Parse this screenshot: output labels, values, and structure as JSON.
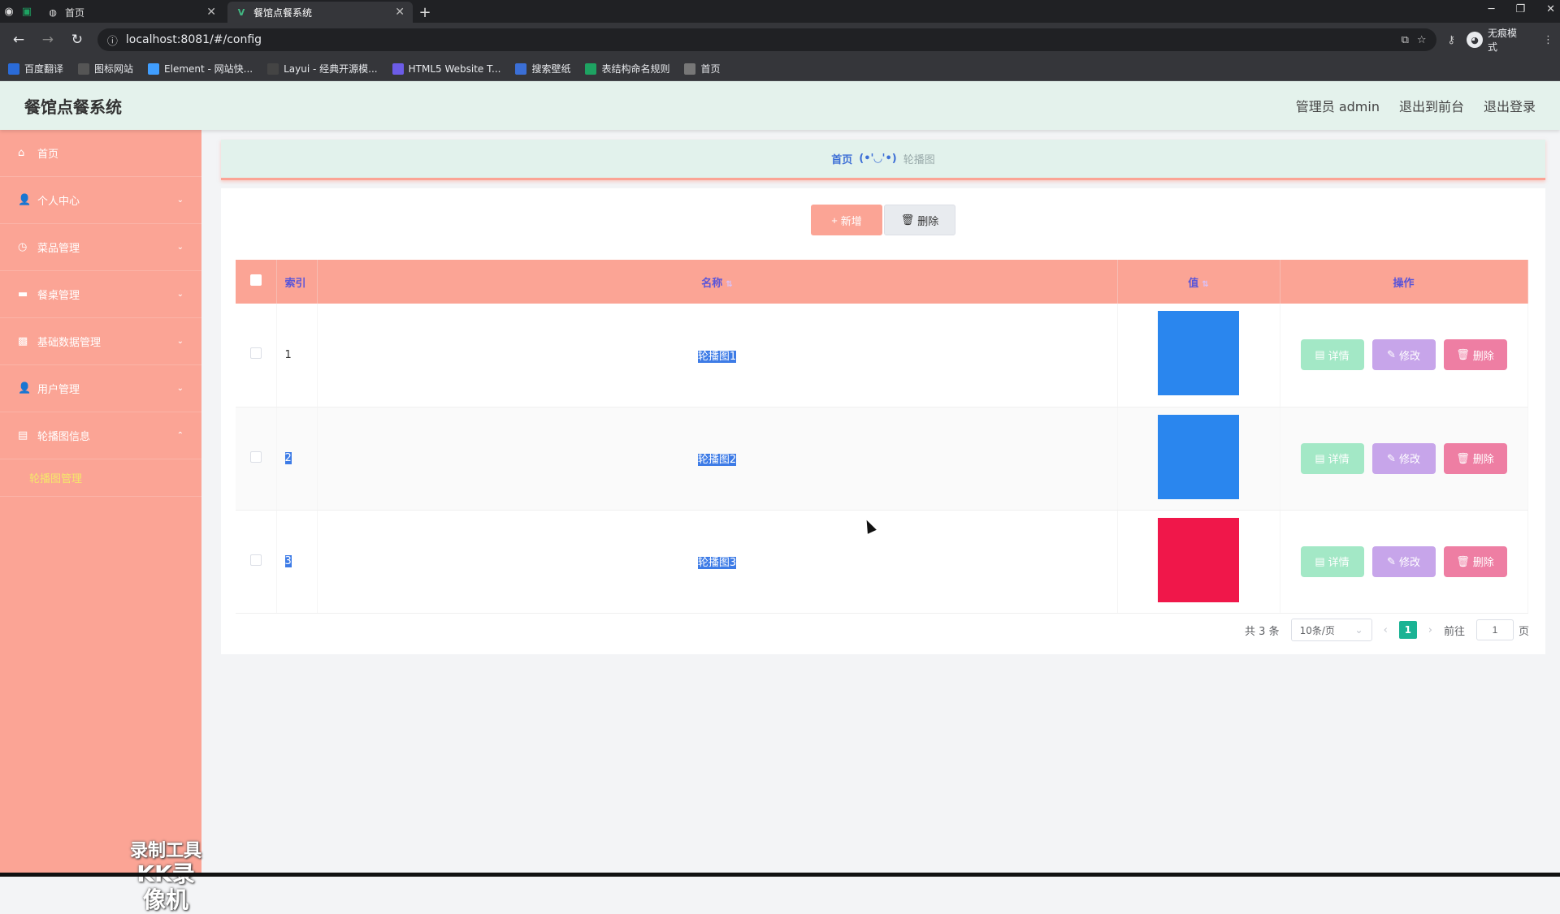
{
  "browser": {
    "tabs": [
      {
        "label": "首页",
        "icon": "globe-icon",
        "active": false
      },
      {
        "label": "餐馆点餐系统",
        "icon": "vue-icon",
        "active": true
      }
    ],
    "url": "localhost:8081/#/config",
    "profile_label": "无痕模式",
    "bookmarks": [
      {
        "label": "百度翻译",
        "color": "#2a6bd8"
      },
      {
        "label": "图标网站",
        "color": "#555555"
      },
      {
        "label": "Element - 网站快...",
        "color": "#409eff"
      },
      {
        "label": "Layui - 经典开源模...",
        "color": "#444444"
      },
      {
        "label": "HTML5 Website T...",
        "color": "#6c5ce7"
      },
      {
        "label": "搜索壁纸",
        "color": "#3b6fd6"
      },
      {
        "label": "表结构命名规则",
        "color": "#1ea362"
      },
      {
        "label": "首页",
        "color": "#777777"
      }
    ]
  },
  "app": {
    "title": "餐馆点餐系统",
    "header_links": [
      "管理员 admin",
      "退出到前台",
      "退出登录"
    ]
  },
  "sidebar": {
    "items": [
      {
        "label": "首页",
        "icon": "home-icon",
        "expandable": false
      },
      {
        "label": "个人中心",
        "icon": "user-icon",
        "expandable": true
      },
      {
        "label": "菜品管理",
        "icon": "clock-icon",
        "expandable": true
      },
      {
        "label": "餐桌管理",
        "icon": "message-icon",
        "expandable": true
      },
      {
        "label": "基础数据管理",
        "icon": "picture-icon",
        "expandable": true
      },
      {
        "label": "用户管理",
        "icon": "user-icon",
        "expandable": true
      },
      {
        "label": "轮播图信息",
        "icon": "suitcase-icon",
        "expandable": true,
        "expanded": true
      }
    ],
    "submenu": {
      "label": "轮播图管理"
    },
    "watermark": {
      "line1": "录制工具",
      "line2": "KK录像机"
    }
  },
  "breadcrumb": {
    "home": "首页",
    "separator": "(•'◡'•)",
    "current": "轮播图"
  },
  "actions": {
    "add_label": "新增",
    "delete_label": "删除"
  },
  "table": {
    "headers": {
      "index": "索引",
      "name": "名称",
      "value": "值",
      "actions": "操作"
    },
    "rows": [
      {
        "index": "1",
        "name": "轮播图1",
        "image_color": "#2a86ee"
      },
      {
        "index": "2",
        "name": "轮播图2",
        "image_color": "#2a86ee"
      },
      {
        "index": "3",
        "name": "轮播图3",
        "image_color": "#f0174a"
      }
    ],
    "row_actions": {
      "detail": "详情",
      "edit": "修改",
      "remove": "删除"
    }
  },
  "pagination": {
    "total_label": "共 3 条",
    "page_size": "10条/页",
    "current_page": "1",
    "goto_prefix": "前往",
    "goto_value": "1",
    "goto_suffix": "页"
  }
}
